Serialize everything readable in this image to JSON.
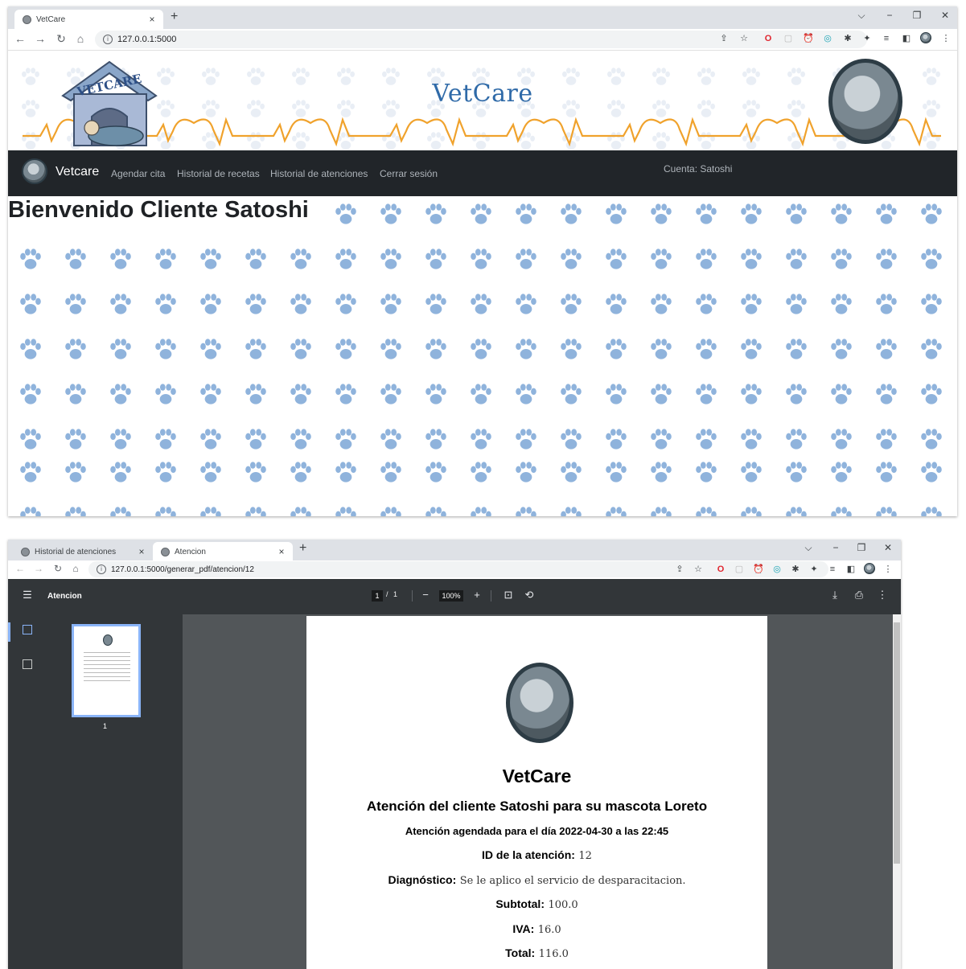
{
  "window1": {
    "tab": {
      "title": "VetCare",
      "close": "×"
    },
    "new_tab": "+",
    "address": "127.0.0.1:5000",
    "controls": {
      "chevron": "⌵",
      "minimize": "−",
      "restore": "❐",
      "close": "✕"
    }
  },
  "site": {
    "logo_text": "VETCARE",
    "title": "VetCare",
    "nav": {
      "brand": "Vetcare",
      "links": [
        "Agendar cita",
        "Historial de recetas",
        "Historial de atenciones",
        "Cerrar sesión"
      ],
      "account": "Cuenta: Satoshi"
    },
    "welcome": "Bienvenido Cliente Satoshi",
    "colors": {
      "paw": "#8fb3dc",
      "nav_bg": "#212529",
      "title": "#2f6aa8",
      "heartbeat": "#f0a22c"
    }
  },
  "window2": {
    "tabs": [
      {
        "title": "Historial de atenciones",
        "close": "×"
      },
      {
        "title": "Atencion",
        "close": "×"
      }
    ],
    "new_tab": "+",
    "address": "127.0.0.1:5000/generar_pdf/atencion/12",
    "controls": {
      "chevron": "⌵",
      "minimize": "−",
      "restore": "❐",
      "close": "✕"
    }
  },
  "pdf": {
    "title": "Atencion",
    "page_current": "1",
    "page_sep": "/",
    "page_total": "1",
    "zoom": "100%",
    "thumbnail_label": "1",
    "content": {
      "heading": "VetCare",
      "subheading": "Atención del cliente Satoshi para su mascota Loreto",
      "scheduled": "Atención agendada para el día 2022-04-30 a las 22:45",
      "fields": [
        {
          "label": "ID de la atención:",
          "value": "12"
        },
        {
          "label": "Diagnóstico:",
          "value": "Se le aplico el servicio de desparacitacion."
        },
        {
          "label": "Subtotal:",
          "value": "100.0"
        },
        {
          "label": "IVA:",
          "value": "16.0"
        },
        {
          "label": "Total:",
          "value": "116.0"
        }
      ]
    }
  }
}
